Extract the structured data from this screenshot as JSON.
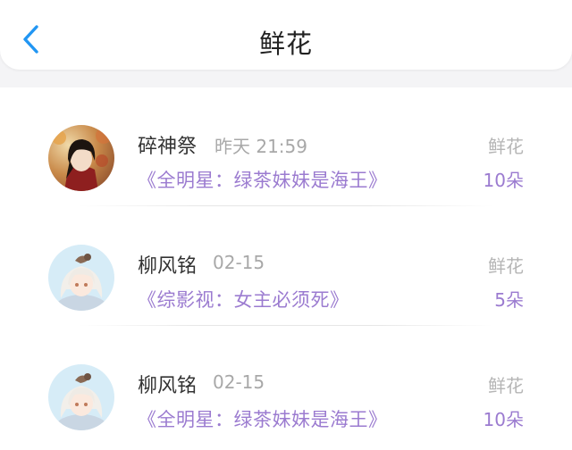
{
  "header": {
    "title": "鲜花",
    "back_icon": "chevron-left-icon",
    "accent_color": "#2196f3"
  },
  "records": [
    {
      "user": "碎神祭",
      "time": "昨天 21:59",
      "book": "《全明星：绿茶妹妹是海王》",
      "gift": "鲜花",
      "count": "10朵",
      "avatar": "avatar-dark-haired-character"
    },
    {
      "user": "柳风铭",
      "time": "02-15",
      "book": "《综影视：女主必须死》",
      "gift": "鲜花",
      "count": "5朵",
      "avatar": "avatar-white-haired-character"
    },
    {
      "user": "柳风铭",
      "time": "02-15",
      "book": "《全明星：绿茶妹妹是海王》",
      "gift": "鲜花",
      "count": "10朵",
      "avatar": "avatar-white-haired-character"
    }
  ],
  "colors": {
    "book_title": "#9b7bd0",
    "timestamp": "#a8a8a8"
  }
}
